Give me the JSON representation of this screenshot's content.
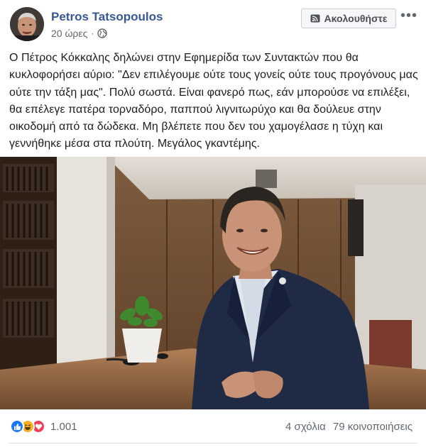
{
  "post": {
    "author": "Petros Tatsopoulos",
    "time": "20 ώρες",
    "separator": "·",
    "follow_label": "Ακολουθήστε",
    "more_label": "•••",
    "text": "Ο Πέτρος Κόκκαλης δηλώνει στην Εφημερίδα των Συντακτών που θα κυκλοφορήσει αύριο: \"Δεν επιλέγουμε ούτε τους γονείς ούτε τους προγόνους μας ούτε την τάξη μας\". Πολύ σωστά. Είναι φανερό πως, εάν μπορούσε να επιλέξει, θα επέλεγε πατέρα τορναδόρο, παππού λιγνιτωρύχο και θα δούλευε στην οικοδομή από τα δώδεκα. Μη βλέπετε που δεν του χαμογέλασε η τύχη και γεννήθηκε μέσα στα πλούτη. Μεγάλος γκαντέμης."
  },
  "footer": {
    "reactions_count": "1.001",
    "reaction_icons": [
      "like-icon",
      "haha-icon",
      "love-icon"
    ],
    "comments": "4 σχόλια",
    "shares": "79 κοινοποιήσεις"
  },
  "colors": {
    "author_link": "#385898",
    "like": "#1877f2",
    "haha": "#f7b125",
    "love": "#f33e58"
  }
}
